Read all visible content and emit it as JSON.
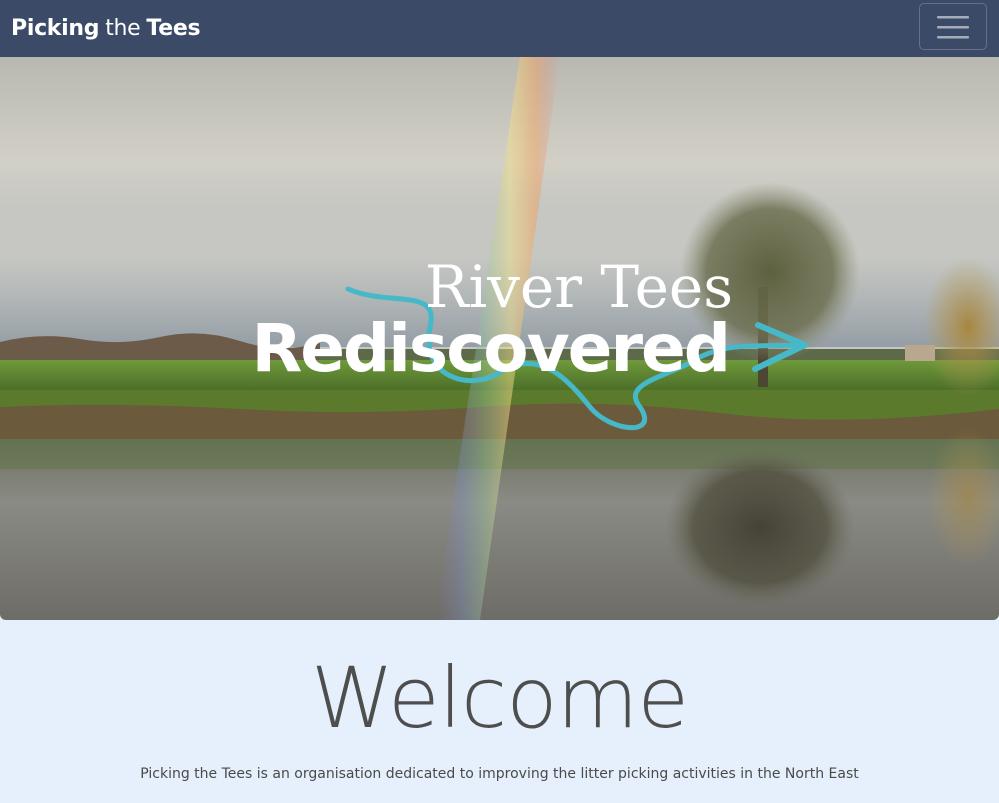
{
  "navbar": {
    "brand_part1": "Picking",
    "brand_part2": "the",
    "brand_part3": "Tees",
    "menu_icon": "hamburger-menu-icon",
    "background_color": "#3b4a67"
  },
  "hero": {
    "title_line1": "River Tees",
    "title_line2": "Rediscovered",
    "arrow_color": "#47b8c8",
    "image_description": "rainbow-over-river-icon"
  },
  "welcome": {
    "title": "Welcome",
    "text": "Picking the Tees is an organisation dedicated to improving the litter picking activities in the North East"
  },
  "colors": {
    "page_background": "#e6f0fc",
    "text_dark": "#4e4e4e"
  }
}
